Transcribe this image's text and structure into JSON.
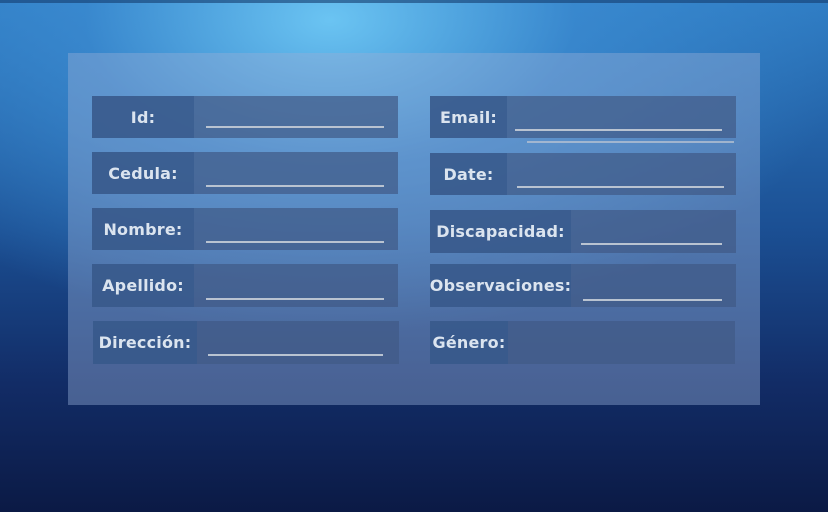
{
  "form": {
    "left": [
      {
        "label": "Id:"
      },
      {
        "label": "Cedula:"
      },
      {
        "label": "Nombre:"
      },
      {
        "label": "Apellido:"
      },
      {
        "label": "Dirección:"
      }
    ],
    "right": [
      {
        "label": "Email:"
      },
      {
        "label": "Date:"
      },
      {
        "label": "Discapacidad:"
      },
      {
        "label": "Observaciones:"
      },
      {
        "label": "Género:"
      }
    ]
  }
}
